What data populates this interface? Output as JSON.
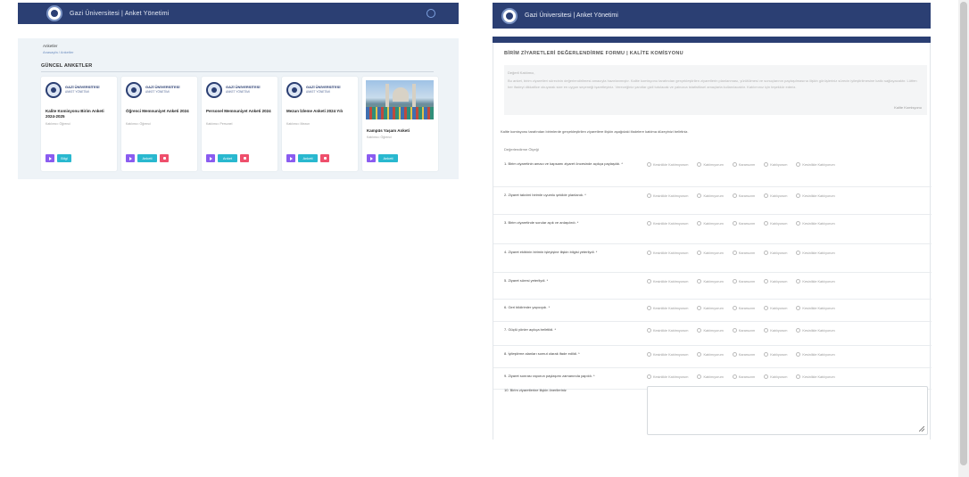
{
  "left": {
    "header_title": "Gazi Üniversitesi | Anket Yönetimi",
    "breadcrumb_current": "Anketler",
    "breadcrumb_links": "Anasayfa / Anketler",
    "section_title": "GÜNCEL ANKETLER",
    "cards": [
      {
        "brand": "GAZİ ÜNİVERSİTESİ",
        "brand2": "ANKET YÖNETİMİ",
        "name": "Kalite Komisyonu Birim Anketi 2024-2025",
        "sub": "Katılımcı: Öğrenci",
        "action_label": "Bilgi",
        "has_delete": false
      },
      {
        "brand": "GAZİ ÜNİVERSİTESİ",
        "brand2": "ANKET YÖNETİMİ",
        "name": "Öğrenci Memnuniyet Anketi 2024",
        "sub": "Katılımcı: Öğrenci",
        "action_label": "Anketi",
        "has_delete": true
      },
      {
        "brand": "GAZİ ÜNİVERSİTESİ",
        "brand2": "ANKET YÖNETİMİ",
        "name": "Personel Memnuniyet Anketi 2024",
        "sub": "Katılımcı: Personel",
        "action_label": "Anket",
        "has_delete": true
      },
      {
        "brand": "GAZİ ÜNİVERSİTESİ",
        "brand2": "ANKET YÖNETİMİ",
        "name": "Mezun İzleme Anketi 2024 Yılı",
        "sub": "Katılımcı: Mezun",
        "action_label": "Anketi",
        "has_delete": true
      }
    ],
    "photo_card": {
      "name": "Kampüs Yaşam Anketi",
      "sub": "Katılımcı: Öğrenci",
      "action_label": "Anketi"
    }
  },
  "right": {
    "header_title": "Gazi Üniversitesi | Anket Yönetimi",
    "form_title": "BİRİM ZİYARETLERİ DEĞERLENDİRME FORMU | KALİTE KOMİSYONU",
    "info_heading": "Değerli Katılımcı,",
    "info_text": "Bu anket, birim ziyaretleri sürecinin değerlendirilmesi amacıyla hazırlanmıştır. Kalite komisyonu tarafından gerçekleştirilen ziyaretlerin planlanması, yürütülmesi ve sonuçlarının paylaşılmasına ilişkin görüşleriniz sürecin iyileştirilmesine katkı sağlayacaktır. Lütfen her ifadeyi dikkatlice okuyarak size en uygun seçeneği işaretleyiniz. Vereceğiniz yanıtlar gizli tutulacak ve yalnızca istatistiksel amaçlarla kullanılacaktır. Katılımınız için teşekkür ederiz.",
    "signature": "Kalite Komisyonu",
    "intro": "Kalite komisyonu tarafından birimlerde gerçekleştirilen ziyaretlere ilişkin aşağıdaki ifadelere katılma düzeyinizi belirtiniz.",
    "scale_label": "Değerlendirme Ölçeği",
    "options": [
      "Kesinlikle Katılmıyorum",
      "Katılmıyorum",
      "Kararsızım",
      "Katılıyorum",
      "Kesinlikle Katılıyorum"
    ],
    "questions": [
      "1. Birim ziyaretinin amacı ve kapsamı ziyaret öncesinde açıkça paylaşıldı. *",
      "2. Ziyaret takvimi birimle uyumlu şekilde planlandı. *",
      "3. Birim ziyaretinde sorular açık ve anlaşılırdı. *",
      "4. Ziyaret ekibinin birimin işleyişine ilişkin bilgisi yeterliydi. *",
      "5. Ziyaret süresi yeterliydi. *",
      "6. Geri bildirimler yapıcıydı. *",
      "7. Güçlü yönler açıkça belirtildi. *",
      "8. İyileştirme alanları somut olarak ifade edildi. *",
      "9. Ziyaret sonrası raporun paylaşımı zamanında yapıldı. *"
    ],
    "last_question": "10. Birim ziyaretlerine ilişkin önerileriniz"
  }
}
